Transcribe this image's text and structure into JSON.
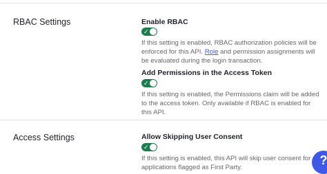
{
  "rbac_section": {
    "title": "RBAC Settings",
    "enable_rbac": {
      "label": "Enable RBAC",
      "enabled": true,
      "desc_before_link": "If this setting is enabled, RBAC authorization policies will be enforced for this API. ",
      "desc_link": "Role",
      "desc_after_link": " and permission assignments will be evaluated during the login transaction."
    },
    "add_permissions": {
      "label": "Add Permissions in the Access Token",
      "enabled": true,
      "description": "If this setting is enabled, the Permissions claim will be added to the access token. Only available if RBAC is enabled for this API."
    }
  },
  "access_section": {
    "title": "Access Settings",
    "allow_skip_consent": {
      "label": "Allow Skipping User Consent",
      "enabled": true,
      "description": "If this setting is enabled, this API will skip user consent for applications flagged as First Party."
    }
  },
  "help_button": {
    "label": "?"
  },
  "colors": {
    "toggle_on": "#1d7c4d",
    "link": "#3f59e4",
    "divider": "#e3e4e6",
    "help_button": "#3f59e4"
  }
}
